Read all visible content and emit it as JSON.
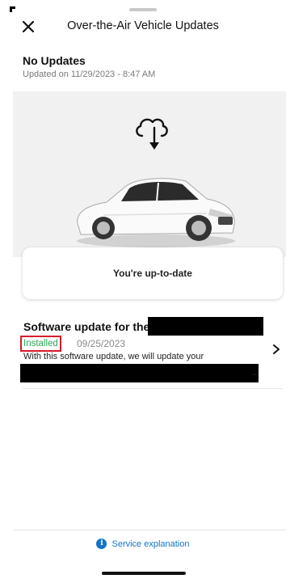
{
  "header": {
    "title": "Over-the-Air Vehicle Updates",
    "close_icon": "close-icon"
  },
  "status": {
    "title": "No Updates",
    "updated": "Updated on 11/29/2023 - 8:47 AM"
  },
  "hero": {
    "icon": "cloud-download-icon",
    "image": "white-sedan"
  },
  "card": {
    "message": "You're up-to-date"
  },
  "update": {
    "title": "Software update for the",
    "status_badge": "Installed",
    "date": "09/25/2023",
    "description": "With this software update, we will update your",
    "truncation": "...",
    "chevron_icon": "chevron-right-icon"
  },
  "footer": {
    "link_label": "Service explanation",
    "icon": "info-icon"
  },
  "colors": {
    "accent_blue": "#1473c6",
    "installed_green": "#2aa65a",
    "highlight_red": "#d81b2a",
    "hero_bg": "#f1f1f1"
  }
}
